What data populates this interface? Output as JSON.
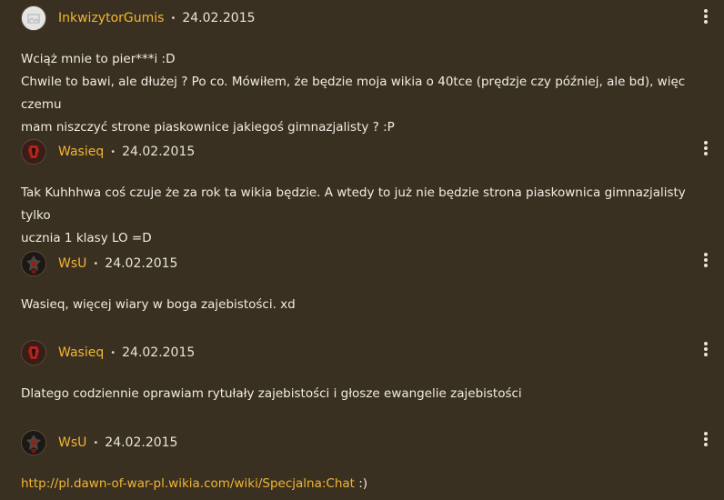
{
  "comments": [
    {
      "author": "InkwizytorGumis",
      "date": "24.02.2015",
      "avatar_icon": "default-avatar-icon",
      "lines": [
        "Wciąż mnie to pier***i :D",
        "Chwile to bawi, ale dłużej ? Po co. Mówiłem, że będzie moja wikia o 40tce (prędzje czy później, ale bd), więc czemu",
        "mam niszczyć strone piaskownice jakiegoś gimnazjalisty ? :P"
      ]
    },
    {
      "author": "Wasieq",
      "date": "24.02.2015",
      "avatar_icon": "red-emblem-avatar-icon",
      "lines": [
        "Tak Kuhhhwa coś czuje że za rok ta wikia będzie. A wtedy to już nie będzie strona piaskownica gimnazjalisty tylko",
        "ucznia 1 klasy LO =D"
      ]
    },
    {
      "author": "WsU",
      "date": "24.02.2015",
      "avatar_icon": "warrior-avatar-icon",
      "lines": [
        "Wasieq, więcej wiary w boga zajebistości. xd"
      ]
    },
    {
      "author": "Wasieq",
      "date": "24.02.2015",
      "avatar_icon": "red-emblem-avatar-icon",
      "lines": [
        "Dlatego codziennie oprawiam rytułały zajebistości i głosze ewangelie zajebistości"
      ]
    },
    {
      "author": "WsU",
      "date": "24.02.2015",
      "avatar_icon": "warrior-avatar-icon",
      "link": "http://pl.dawn-of-war-pl.wikia.com/wiki/Specjalna:Chat",
      "link_suffix": " :)"
    }
  ],
  "separator": "•",
  "colors": {
    "background": "#3a3022",
    "author": "#f2b630",
    "text": "#f1ece3"
  }
}
